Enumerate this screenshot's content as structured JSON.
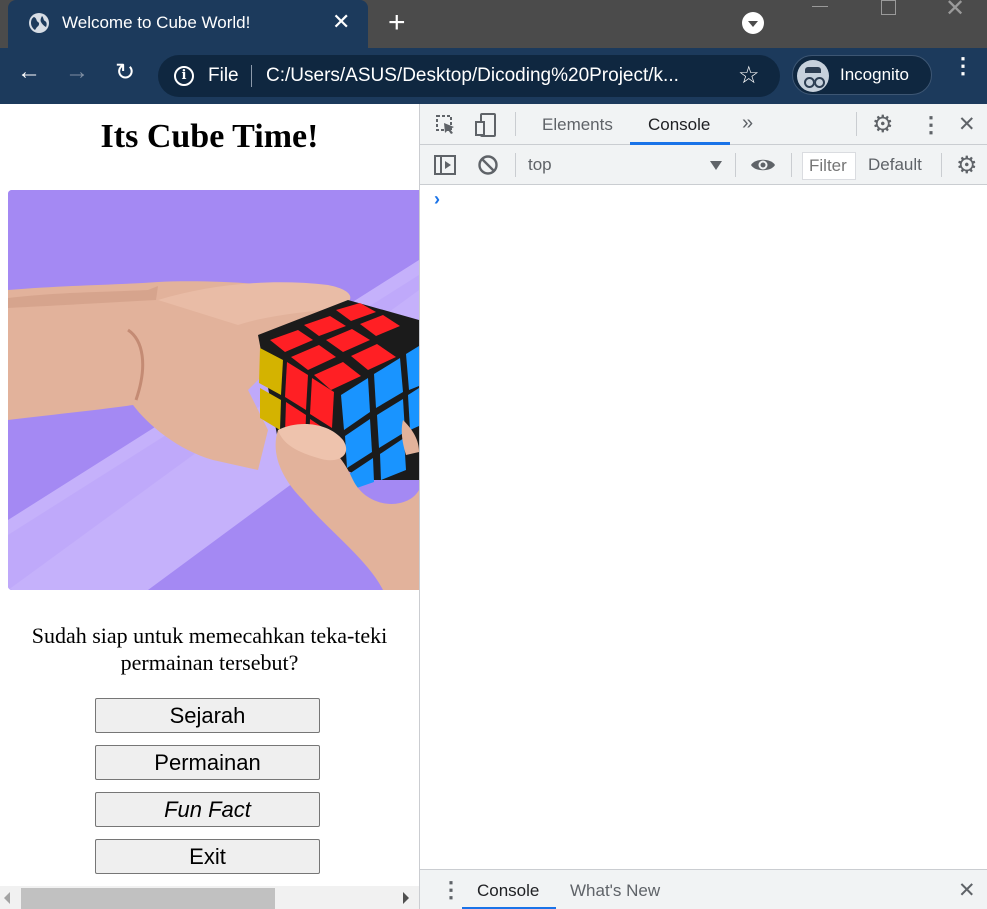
{
  "browser": {
    "tab": {
      "title": "Welcome to Cube World!",
      "close_icon": "✕",
      "favicon": "globe-icon"
    },
    "new_tab_icon": "+",
    "window_controls": {
      "close_icon": "✕"
    },
    "toolbar": {
      "back_icon": "←",
      "forward_icon": "→",
      "reload_icon": "↻",
      "omnibox": {
        "info_icon": "i",
        "scheme_label": "File",
        "url": "C:/Users/ASUS/Desktop/Dicoding%20Project/k...",
        "star_icon": "☆"
      },
      "incognito_label": "Incognito",
      "menu_icon": "⋮"
    }
  },
  "page": {
    "title": "Its Cube Time!",
    "hero_image": "hands-solving-rubiks-cube",
    "question": "Sudah siap untuk memecahkan teka-teki permainan tersebut?",
    "buttons": {
      "history": "Sejarah",
      "game": "Permainan",
      "fun_fact": "Fun Fact",
      "exit": "Exit"
    }
  },
  "devtools": {
    "tabs": {
      "elements": "Elements",
      "console": "Console",
      "more": "»"
    },
    "selected_tab": "Console",
    "settings_icon": "⚙",
    "kebab_icon": "⋮",
    "close_icon": "✕",
    "console_toolbar": {
      "context": "top",
      "filter_placeholder": "Filter",
      "levels": "Default",
      "settings_icon": "⚙"
    },
    "prompt": "›",
    "drawer": {
      "menu_icon": "⋮",
      "tabs": {
        "console": "Console",
        "whats_new": "What's New"
      },
      "close_icon": "✕"
    }
  },
  "colors": {
    "chrome_dark": "#1c3a5c",
    "tabstrip": "#4b4b4b",
    "accent_blue": "#1a73e8",
    "hero_purple": "#a489f3"
  }
}
